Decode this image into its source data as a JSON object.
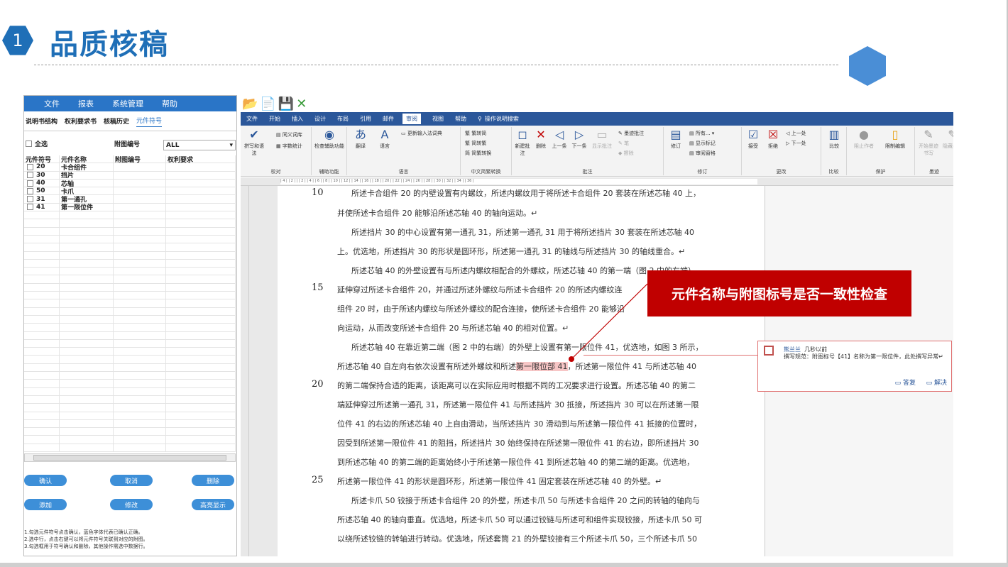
{
  "slide": {
    "number": "1",
    "title": "品质核稿"
  },
  "left_panel": {
    "menu": [
      "文件",
      "报表",
      "系统管理",
      "帮助"
    ],
    "tabs": [
      "说明书结构",
      "权利要求书",
      "核稿历史",
      "元件符号"
    ],
    "select_all_label": "全选",
    "figure_number_label": "附图编号",
    "figure_number_value": "ALL",
    "columns": [
      "元件符号",
      "元件名称",
      "附图编号",
      "权利要求"
    ],
    "rows": [
      {
        "symbol": "20",
        "name": "卡合组件"
      },
      {
        "symbol": "30",
        "name": "挡片"
      },
      {
        "symbol": "40",
        "name": "芯轴"
      },
      {
        "symbol": "50",
        "name": "卡爪"
      },
      {
        "symbol": "31",
        "name": "第一通孔"
      },
      {
        "symbol": "41",
        "name": "第一限位件"
      }
    ],
    "buttons": {
      "confirm": "确认",
      "cancel": "取消",
      "delete": "删除",
      "add": "添加",
      "modify": "修改",
      "highlight": "高亮显示"
    },
    "notes": [
      "1.勾选元件符号点击确认，蓝色字体代表已确认正确。",
      "2.选中行，点击右键可以将元件符号关联到对应的附图。",
      "3.勾选框用于符号确认和删除，其他操作需选中数据行。"
    ]
  },
  "word": {
    "ribbon_tabs": [
      "文件",
      "开始",
      "插入",
      "设计",
      "布局",
      "引用",
      "邮件",
      "审阅",
      "视图",
      "帮助",
      "操作说明搜索"
    ],
    "active_tab": "审阅",
    "groups": {
      "proofing": {
        "label": "校对",
        "spelling": "拼写和语法",
        "thesaurus": "同义词库",
        "word_count": "字数统计"
      },
      "assist": {
        "label": "辅助功能",
        "check": "检查辅助功能"
      },
      "language": {
        "label": "语言",
        "translate": "翻译",
        "language": "语言",
        "ime": "更新输入法词典"
      },
      "chinese": {
        "label": "中文简繁转换",
        "t2s": "繁转简",
        "s2t": "简转繁",
        "convert": "简繁转换"
      },
      "comments": {
        "label": "批注",
        "new": "新建批注",
        "delete": "删除",
        "prev": "上一条",
        "next": "下一条",
        "show": "显示批注",
        "ink": "墨迹批注",
        "pen": "笔",
        "eraser": "擦除"
      },
      "tracking": {
        "label": "修订",
        "track": "修订",
        "all": "所有...",
        "markup": "显示标记",
        "pane": "审阅窗格"
      },
      "changes": {
        "label": "更改",
        "accept": "接受",
        "reject": "拒绝",
        "prev": "上一处",
        "next": "下一处"
      },
      "compare": {
        "label": "比较",
        "compare": "比较"
      },
      "protect": {
        "label": "保护",
        "block": "阻止作者",
        "restrict": "限制编辑"
      },
      "ink": {
        "label": "墨迹",
        "start": "开始墨迹书写",
        "hide": "隐藏墨迹"
      }
    },
    "ruler_text": "| 4 |  | 2 |  |  | 2 |  | 4 |  | 6 |  | 8 |  | 10 |  | 12 |  | 14 |  | 16 |  | 18 |  | 20 |  | 22 |  | 24 |  | 26 |  | 28 |  | 30 |  | 32 |  | 34 |  | 36 |",
    "line_numbers": [
      "10",
      "15",
      "20",
      "25"
    ],
    "doc_lines": [
      "所述卡合组件 20 的内壁设置有内螺纹，所述内螺纹用于将所述卡合组件 20 套装在所述芯轴 40 上，",
      "并使所述卡合组件 20 能够沿所述芯轴 40 的轴向运动。↵",
      "所述挡片 30 的中心设置有第一通孔 31，所述第一通孔 31 用于将所述挡片 30 套装在所述芯轴 40",
      "上。优选地，所述挡片 30 的形状是圆环形，所述第一通孔 31 的轴线与所述挡片 30 的轴线重合。↵",
      "所述芯轴 40 的外壁设置有与所述内螺纹相配合的外螺纹，所述芯轴 40 的第一端（图 2 中的左端）",
      "延伸穿过所述卡合组件 20，并通过所述外螺纹与所述卡合组件 20 的所述内螺纹连",
      "组件 20 时，由于所述内螺纹与所述外螺纹的配合连接，使所述卡合组件 20 能够沿",
      "向运动，从而改变所述卡合组件 20 与所述芯轴 40 的相对位置。↵",
      "所述芯轴 40 在靠近第二端（图 2 中的右端）的外壁上设置有第一限位件 41，优选地，如图 3 所示，",
      "所述芯轴 40 自左向右依次设置有所述外螺纹和所述",
      "的第二端保持合适的距离，该距离可以在实际应用时根据不同的工况要求进行设置。所述芯轴 40 的第二",
      "端延伸穿过所述第一通孔 31，所述第一限位件 41 与所述挡片 30 抵接，所述挡片 30 可以在所述第一限",
      "位件 41 的右边的所述芯轴 40 上自由滑动，当所述挡片 30 滑动到与所述第一限位件 41 抵接的位置时，",
      "因受到所述第一限位件 41 的阻挡，所述挡片 30 始终保持在所述第一限位件 41 的右边，即所述挡片 30",
      "到所述芯轴 40 的第二端的距离始终小于所述第一限位件 41 到所述芯轴 40 的第二端的距离。优选地，",
      "所述第一限位件 41 的形状是圆环形，所述第一限位件 41 固定套装在所述芯轴 40 的外壁。↵",
      "所述卡爪 50 铰接于所述卡合组件 20 的外壁，所述卡爪 50 与所述卡合组件 20 之间的转轴的轴向与",
      "所述芯轴 40 的轴向垂直。优选地，所述卡爪 50 可以通过铰链与所述可和组件实现铰接，所述卡爪 50 可",
      "以绕所述铰链的转轴进行转动。优选地，所述套筒 21 的外壁铰接有三个所述卡爪 50，三个所述卡爪 50"
    ],
    "highlight_text": "第一限位部 41",
    "after_highlight": "，所述第一限位件 41 与所述芯轴 40"
  },
  "callout": "元件名称与附图标号是否一致性检查",
  "comment": {
    "author": "熊兰兰",
    "time": "几秒以前",
    "text": "撰写规范：附图标号【41】名称为第一限位件，此处撰写异常↵",
    "reply": "答复",
    "resolve": "解决"
  }
}
